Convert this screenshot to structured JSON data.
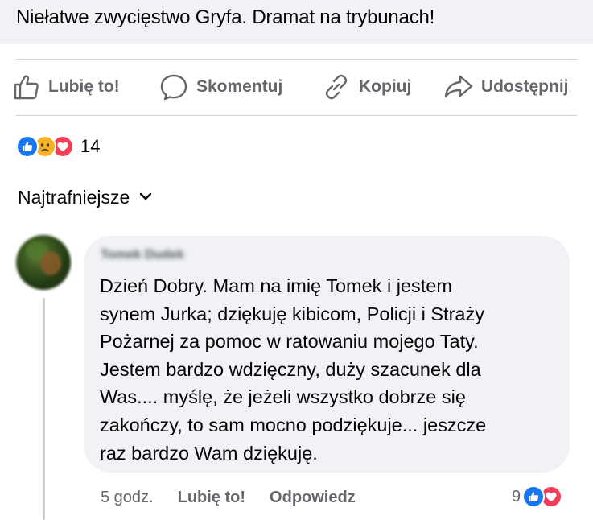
{
  "post": {
    "title": "Niełatwe zwycięstwo Gryfa. Dramat na trybunach!"
  },
  "actions": [
    {
      "label": "Lubię to!",
      "icon": "thumbs-up-icon"
    },
    {
      "label": "Skomentuj",
      "icon": "comment-icon"
    },
    {
      "label": "Kopiuj",
      "icon": "link-icon"
    },
    {
      "label": "Udostępnij",
      "icon": "share-icon"
    }
  ],
  "reactions": {
    "types": [
      "like",
      "sad",
      "love"
    ],
    "count": "14"
  },
  "sort": {
    "label": "Najtrafniejsze",
    "icon": "chevron-down-icon"
  },
  "comment": {
    "author": "Tomek Dudek",
    "lines": [
      "Dzień Dobry. Mam na imię Tomek i jestem",
      "synem Jurka; dziękuję kibicom, Policji i Straży",
      "Pożarnej za pomoc w ratowaniu mojego Taty.",
      "Jestem bardzo wdzięczny, duży szacunek dla",
      "Was.... myślę, że jeżeli wszystko dobrze się",
      "zakończy, to sam mocno podziękuje... jeszcze",
      "raz bardzo Wam dziękuję."
    ],
    "time": "5 godz.",
    "like_label": "Lubię to!",
    "reply_label": "Odpowiedz",
    "reaction_count": "9",
    "reaction_types": [
      "like",
      "love"
    ]
  },
  "colors": {
    "like": "#1877f2",
    "love": "#f33e58",
    "sad": "#f7b125",
    "muted_text": "#65676b",
    "bubble": "#f0f2f5"
  }
}
